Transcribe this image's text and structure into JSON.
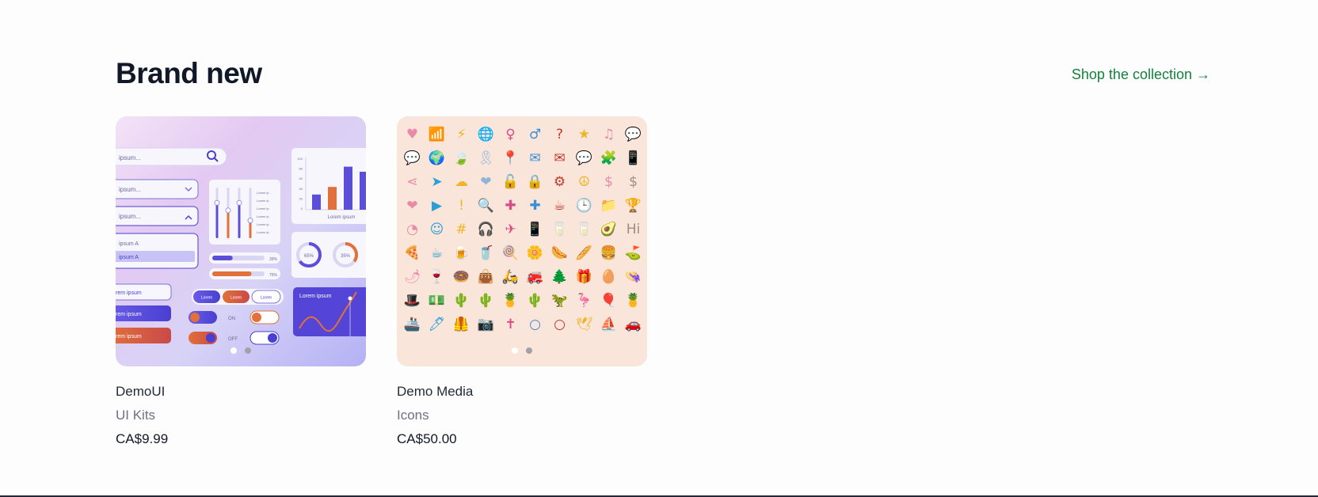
{
  "section": {
    "heading": "Brand new",
    "shop_link": "Shop the collection →"
  },
  "products": [
    {
      "name": "DemoUI",
      "category": "UI Kits",
      "price": "CA$9.99",
      "thumb": {
        "search_placeholder": "ipsum...",
        "dropdown_1": "ipsum...",
        "dropdown_2": "ipsum...",
        "list_item_1": "ipsum A",
        "list_item_2": "ipsum A",
        "input_1": "rem ipsum",
        "button_1": "rem ipsum",
        "button_2": "rem ipsum",
        "chip_1": "Lorem",
        "chip_2": "Lorem",
        "chip_3": "Lorem",
        "toggle_on": "ON",
        "toggle_off": "OFF",
        "progress_1": "39%",
        "progress_2": "75%",
        "donut_1": "65%",
        "donut_2": "35%",
        "chart_caption": "Lorem ipsum",
        "wave_caption": "Lorem ipsum",
        "bar_values": [
          30,
          45,
          85,
          75
        ],
        "slider_levels": [
          0.7,
          0.55,
          0.7,
          0.35
        ],
        "progress_fills": [
          0.39,
          0.75
        ],
        "donut_fills": [
          0.65,
          0.35
        ],
        "legend_items": [
          "Lorem ip",
          "Lorem ip",
          "Lorem ip",
          "Lorem ip",
          "Lorem ip",
          "Lorem ip"
        ],
        "y_ticks": [
          "100",
          "80",
          "60",
          "40",
          "20",
          "0"
        ]
      }
    },
    {
      "name": "Demo Media",
      "category": "Icons",
      "price": "CA$50.00",
      "thumb": {
        "hi_bubble": "Hi",
        "icons": [
          "♥",
          "📶",
          "⚡",
          "🌐",
          "♀",
          "♂",
          "?",
          "★",
          "♫",
          "💬",
          "💬",
          "🌍",
          "🍃",
          "🎗",
          "📍",
          "✉",
          "✉",
          "💬",
          "🧩",
          "📱",
          "⋖",
          "➤",
          "☁",
          "❤",
          "🔓",
          "🔒",
          "⚙",
          "☮",
          "$",
          "$",
          "❤",
          "▶",
          "!",
          "🔍",
          "✚",
          "✚",
          "☕",
          "🕒",
          "📁",
          "🏆",
          "◔",
          "☺",
          "#",
          "🎧",
          "✈",
          "📱",
          "🥛",
          "🥛",
          "🥑",
          "Hi",
          "🍕",
          "☕",
          "🍺",
          "🥤",
          "🍭",
          "🌼",
          "🌭",
          "🥖",
          "🍔",
          "⛳",
          "🌶",
          "🍷",
          "🍩",
          "👜",
          "🛵",
          "🚒",
          "🌲",
          "🎁",
          "🥚",
          "👒",
          "🎩",
          "💵",
          "🌵",
          "🌵",
          "🍍",
          "🌵",
          "🦖",
          "🦩",
          "🎈",
          "🍍",
          "🚢",
          "🖊",
          "🦺",
          "📷",
          "✝",
          "○",
          "○",
          "🕊",
          "⛵",
          "🚗"
        ]
      }
    }
  ],
  "colors": {
    "accent": "#15803d",
    "heading": "#111827",
    "muted": "#6b7280",
    "ui_primary": "#5b4fd9",
    "ui_orange": "#e2703a",
    "media_bg": "#f9e5da"
  },
  "carousel": {
    "active_dot": 0,
    "dot_count": 2
  }
}
